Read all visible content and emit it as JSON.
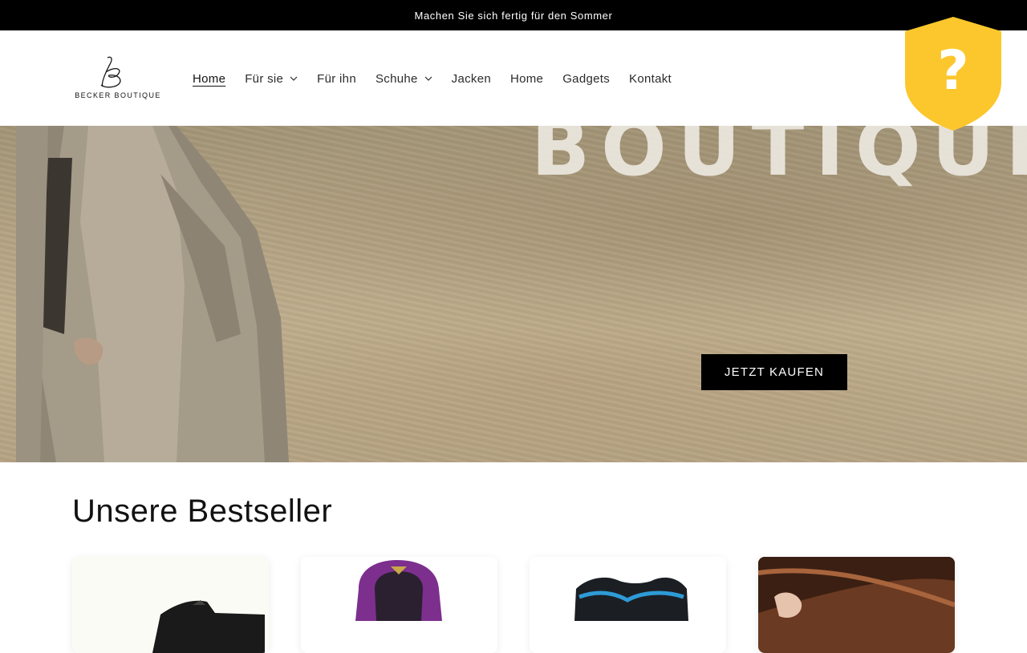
{
  "announcement": {
    "text": "Machen Sie sich fertig für den Sommer"
  },
  "brand": {
    "name": "BECKER BOUTIQUE"
  },
  "nav": {
    "items": [
      {
        "label": "Home",
        "active": true,
        "dropdown": false
      },
      {
        "label": "Für sie",
        "active": false,
        "dropdown": true
      },
      {
        "label": "Für ihn",
        "active": false,
        "dropdown": false
      },
      {
        "label": "Schuhe",
        "active": false,
        "dropdown": true
      },
      {
        "label": "Jacken",
        "active": false,
        "dropdown": false
      },
      {
        "label": "Home",
        "active": false,
        "dropdown": false
      },
      {
        "label": "Gadgets",
        "active": false,
        "dropdown": false
      },
      {
        "label": "Kontakt",
        "active": false,
        "dropdown": false
      }
    ]
  },
  "hero": {
    "background_text": "BOUTIQUE",
    "cta_label": "JETZT KAUFEN"
  },
  "badge": {
    "symbol": "?",
    "color": "#fcc72d",
    "icon": "shield-question-icon"
  },
  "bestsellers": {
    "title": "Unsere Bestseller",
    "products": [
      {
        "image": "sneaker-product-image"
      },
      {
        "image": "purple-jacket-product-image"
      },
      {
        "image": "blue-shirt-product-image"
      },
      {
        "image": "hair-product-image"
      }
    ]
  },
  "colors": {
    "accent": "#000000",
    "background": "#ffffff",
    "badge": "#fcc72d"
  }
}
